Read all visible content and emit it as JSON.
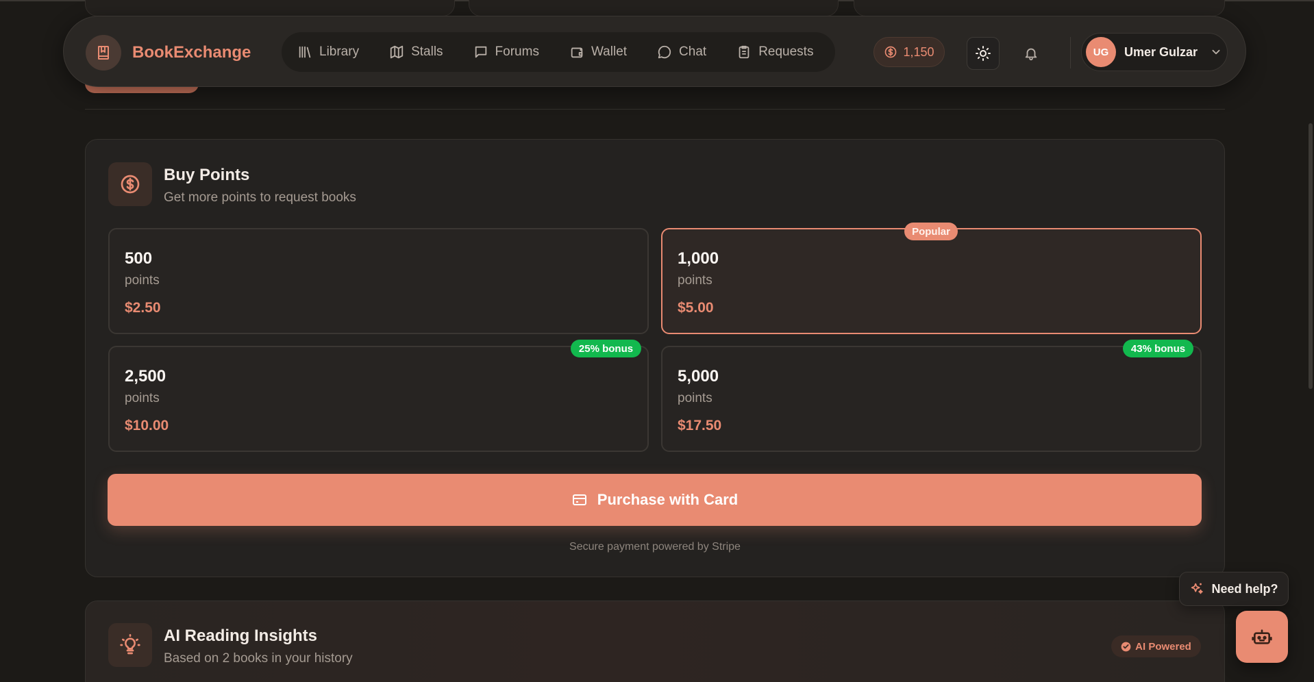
{
  "navbar": {
    "brand": "BookExchange",
    "items": [
      {
        "label": "Library",
        "icon": "library-icon"
      },
      {
        "label": "Stalls",
        "icon": "map-icon"
      },
      {
        "label": "Forums",
        "icon": "message-square-icon"
      },
      {
        "label": "Wallet",
        "icon": "wallet-icon"
      },
      {
        "label": "Chat",
        "icon": "chat-bubble-icon"
      },
      {
        "label": "Requests",
        "icon": "clipboard-icon"
      }
    ],
    "points": "1,150",
    "user_initials": "UG",
    "user_name": "Umer Gulzar"
  },
  "buy_points": {
    "title": "Buy Points",
    "subtitle": "Get more points to request books",
    "options": [
      {
        "amount": "500",
        "unit": "points",
        "price": "$2.50",
        "badge": ""
      },
      {
        "amount": "1,000",
        "unit": "points",
        "price": "$5.00",
        "badge": "Popular",
        "selected": true
      },
      {
        "amount": "2,500",
        "unit": "points",
        "price": "$10.00",
        "badge": "25% bonus"
      },
      {
        "amount": "5,000",
        "unit": "points",
        "price": "$17.50",
        "badge": "43% bonus"
      }
    ],
    "purchase_label": "Purchase with Card",
    "secure_note": "Secure payment powered by Stripe"
  },
  "ai_insights": {
    "title": "AI Reading Insights",
    "subtitle": "Based on 2 books in your history",
    "badge": "AI Powered"
  },
  "help": {
    "label": "Need help?"
  },
  "colors": {
    "accent": "#e98b72",
    "bonus_green": "#12b84e",
    "background": "#1c1a17",
    "card": "#242220"
  }
}
